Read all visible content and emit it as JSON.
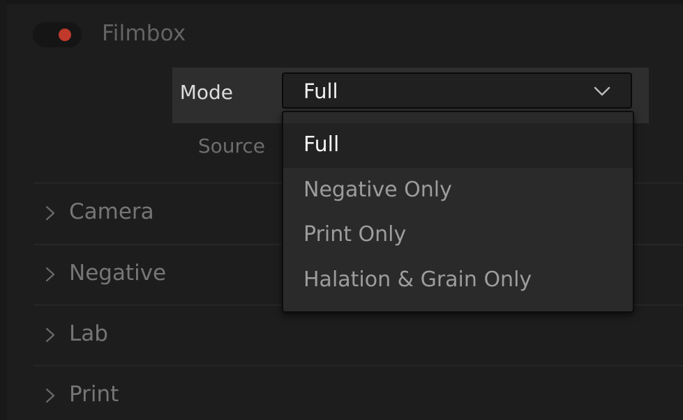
{
  "header": {
    "title": "Filmbox",
    "toggle_color": "#c0392b"
  },
  "mode": {
    "label": "Mode",
    "value": "Full",
    "icon": "chevron-down-icon"
  },
  "source": {
    "label": "Source"
  },
  "sections": [
    {
      "label": "Camera",
      "icon": "chevron-right-icon"
    },
    {
      "label": "Negative",
      "icon": "chevron-right-icon"
    },
    {
      "label": "Lab",
      "icon": "chevron-right-icon"
    },
    {
      "label": "Print",
      "icon": "chevron-right-icon"
    }
  ],
  "dropdown": {
    "options": [
      {
        "label": "Full",
        "selected": true
      },
      {
        "label": "Negative Only",
        "selected": false
      },
      {
        "label": "Print Only",
        "selected": false
      },
      {
        "label": "Halation & Grain Only",
        "selected": false
      }
    ]
  }
}
